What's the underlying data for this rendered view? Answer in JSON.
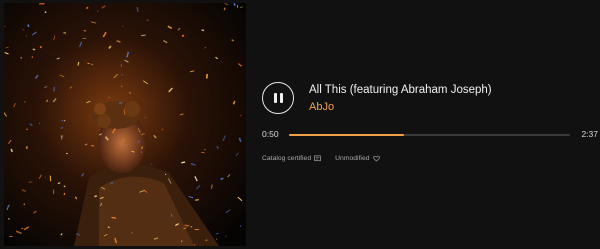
{
  "track": {
    "title": "All This (featuring Abraham Joseph)",
    "artist": "AbJo"
  },
  "playback": {
    "state_icon": "pause-icon",
    "current_time": "0:50",
    "total_time": "2:37",
    "progress": 0.41
  },
  "badges": {
    "catalog_label": "Catalog certified",
    "catalog_icon": "catalog-icon",
    "unmodified_label": "Unmodified",
    "unmodified_icon": "heart-icon"
  },
  "colors": {
    "accent": "#f0a04a",
    "background": "#111111",
    "text": "#f2f2f2",
    "muted": "#a8a8a8"
  }
}
